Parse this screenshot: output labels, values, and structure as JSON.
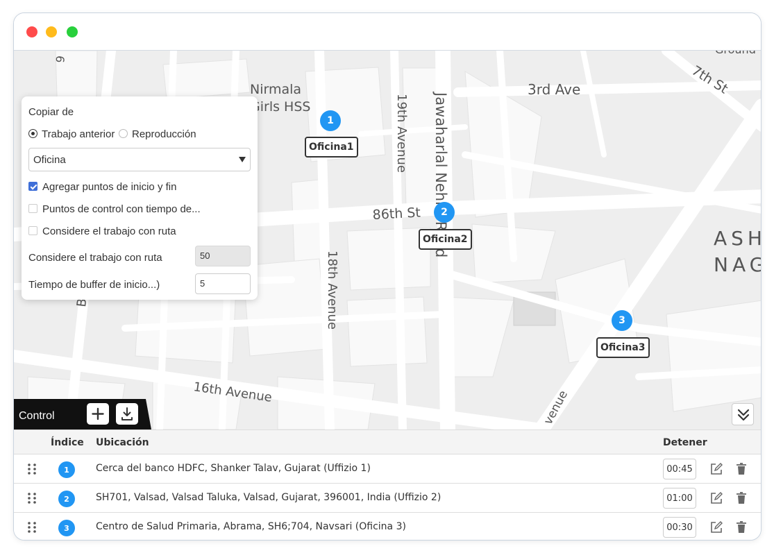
{
  "map": {
    "streets": {
      "nirmala": "Nirmala",
      "girls_hss": "Girls HSS",
      "third_ave": "3rd Ave",
      "seventh_st": "7th St",
      "nineteenth_avenue": "19th Avenue",
      "jawaharlal": "Jawaharlal Nehru Road",
      "eighty_sixth_st": "86th St",
      "eighteenth_avenue": "18th Avenue",
      "sixteenth_avenue": "16th Avenue",
      "ash": "ASH",
      "nag": "NAG",
      "balasu": "Balasu",
      "ground": "Ground",
      "avenue_fragment": "venue",
      "g_fragment": "9",
      "eight_fragment": "8"
    },
    "markers": [
      {
        "index": "1",
        "label": "Oficina1"
      },
      {
        "index": "2",
        "label": "Oficina2"
      },
      {
        "index": "3",
        "label": "Oficina3"
      }
    ]
  },
  "panel": {
    "title": "Copiar de",
    "radio_previous": "Trabajo anterior",
    "radio_playback": "Reproducción",
    "select_value": "Oficina",
    "check_add_points": "Agregar puntos de inicio y fin",
    "check_control_points": "Puntos de control con tiempo de...",
    "check_route": "Considere el trabajo con ruta",
    "field_route_label": "Considere el trabajo con ruta",
    "field_route_value": "50",
    "field_buffer_label": "Tiempo de buffer de inicio...)",
    "field_buffer_value": "5"
  },
  "control": {
    "tab_label": "Control"
  },
  "table": {
    "headers": {
      "index": "Índice",
      "location": "Ubicación",
      "stop": "Detener"
    },
    "rows": [
      {
        "index": "1",
        "location": "Cerca del banco HDFC, Shanker Talav, Gujarat (Uffizio 1)",
        "stop": "00:45"
      },
      {
        "index": "2",
        "location": "SH701, Valsad, Valsad Taluka, Valsad, Gujarat, 396001, India (Uffizio 2)",
        "stop": "01:00"
      },
      {
        "index": "3",
        "location": "Centro de Salud Primaria, Abrama, SH6;704, Navsari (Oficina 3)",
        "stop": "00:30"
      }
    ]
  },
  "colors": {
    "marker": "#2196f3",
    "checkbox": "#3f6fd8",
    "map_background": "#eeeeee"
  }
}
